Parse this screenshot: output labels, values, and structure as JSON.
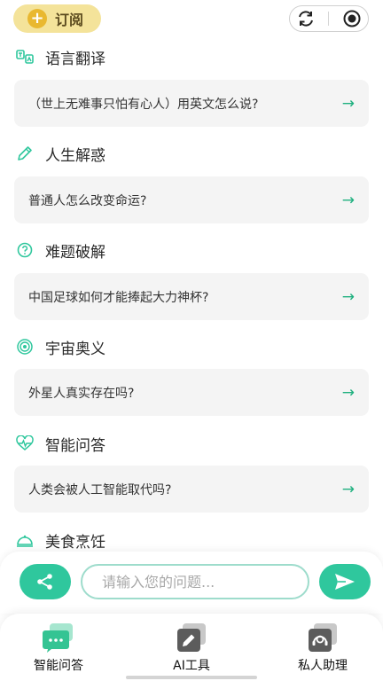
{
  "header": {
    "subscribe_label": "订阅",
    "subscribe_icon": "plus-circle-icon",
    "capsule_icons": [
      "refresh-icon",
      "record-icon"
    ]
  },
  "sections": [
    {
      "title": "语言翻译",
      "icon": "translate-icon",
      "prompt": "（世上无难事只怕有心人）用英文怎么说?"
    },
    {
      "title": "人生解惑",
      "icon": "pencil-icon",
      "prompt": "普通人怎么改变命运?"
    },
    {
      "title": "难题破解",
      "icon": "question-circle-icon",
      "prompt": "中国足球如何才能捧起大力神杯?"
    },
    {
      "title": "宇宙奥义",
      "icon": "cosmos-icon",
      "prompt": "外星人真实存在吗?"
    },
    {
      "title": "智能问答",
      "icon": "heartbeat-icon",
      "prompt": "人类会被人工智能取代吗?"
    },
    {
      "title": "美食烹饪",
      "icon": "cloche-icon"
    }
  ],
  "card_arrow": "→",
  "input": {
    "placeholder": "请输入您的问题..."
  },
  "tabs": [
    {
      "label": "智能问答",
      "icon": "chat-bubble-icon"
    },
    {
      "label": "AI工具",
      "icon": "pencil-tool-icon"
    },
    {
      "label": "私人助理",
      "icon": "headset-icon"
    }
  ],
  "colors": {
    "accent": "#2fc79d",
    "subscribe_bg": "#f4e39a",
    "card_bg": "#f4f4f4"
  }
}
